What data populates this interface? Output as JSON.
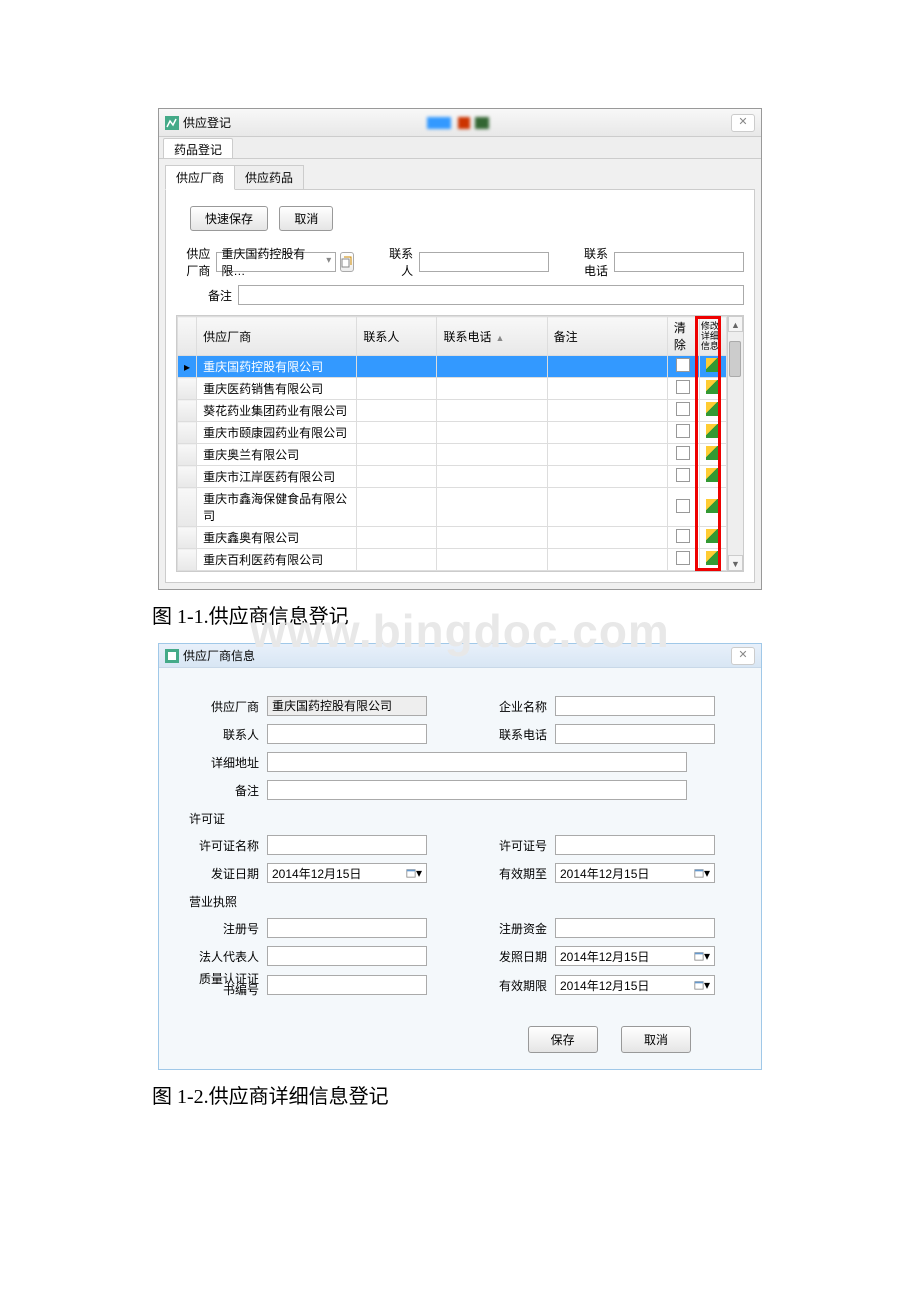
{
  "watermark": "www.bingdoc.com",
  "dlg1": {
    "title": "供应登记",
    "close": "✕",
    "tab": "药品登记",
    "subtabs": {
      "t1": "供应厂商",
      "t2": "供应药品"
    },
    "buttons": {
      "save": "快速保存",
      "cancel": "取消"
    },
    "form": {
      "vendor_label": "供应厂商",
      "vendor_value": "重庆国药控股有限…",
      "contact_label": "联系人",
      "phone_label": "联系电话",
      "remark_label": "备注"
    },
    "grid": {
      "cols": {
        "vendor": "供应厂商",
        "contact": "联系人",
        "phone": "联系电话",
        "remark": "备注",
        "clear": "清除",
        "edit": "修改详细信息"
      },
      "rows": [
        {
          "vendor": "重庆国药控股有限公司",
          "sel": true
        },
        {
          "vendor": "重庆医药销售有限公司"
        },
        {
          "vendor": "葵花药业集团药业有限公司"
        },
        {
          "vendor": "重庆市颐康园药业有限公司"
        },
        {
          "vendor": "重庆奥兰有限公司"
        },
        {
          "vendor": "重庆市江岸医药有限公司"
        },
        {
          "vendor": "重庆市鑫海保健食品有限公司"
        },
        {
          "vendor": "重庆鑫奥有限公司"
        },
        {
          "vendor": "重庆百利医药有限公司"
        }
      ]
    }
  },
  "caption1": "图 1-1.供应商信息登记",
  "dlg2": {
    "title": "供应厂商信息",
    "close": "✕",
    "form": {
      "vendor_lbl": "供应厂商",
      "vendor_val": "重庆国药控股有限公司",
      "company_lbl": "企业名称",
      "contact_lbl": "联系人",
      "phone_lbl": "联系电话",
      "address_lbl": "详细地址",
      "remark_lbl": "备注"
    },
    "license": {
      "section": "许可证",
      "name_lbl": "许可证名称",
      "num_lbl": "许可证号",
      "issue_lbl": "发证日期",
      "issue_val": "2014年12月15日",
      "valid_lbl": "有效期至",
      "valid_val": "2014年12月15日"
    },
    "biz": {
      "section": "营业执照",
      "regnum_lbl": "注册号",
      "capital_lbl": "注册资金",
      "legal_lbl": "法人代表人",
      "photodate_lbl": "发照日期",
      "photodate_val": "2014年12月15日",
      "qacert_lbl": "质量认证证书编号",
      "expire_lbl": "有效期限",
      "expire_val": "2014年12月15日"
    },
    "buttons": {
      "save": "保存",
      "cancel": "取消"
    }
  },
  "caption2": "图 1-2.供应商详细信息登记"
}
